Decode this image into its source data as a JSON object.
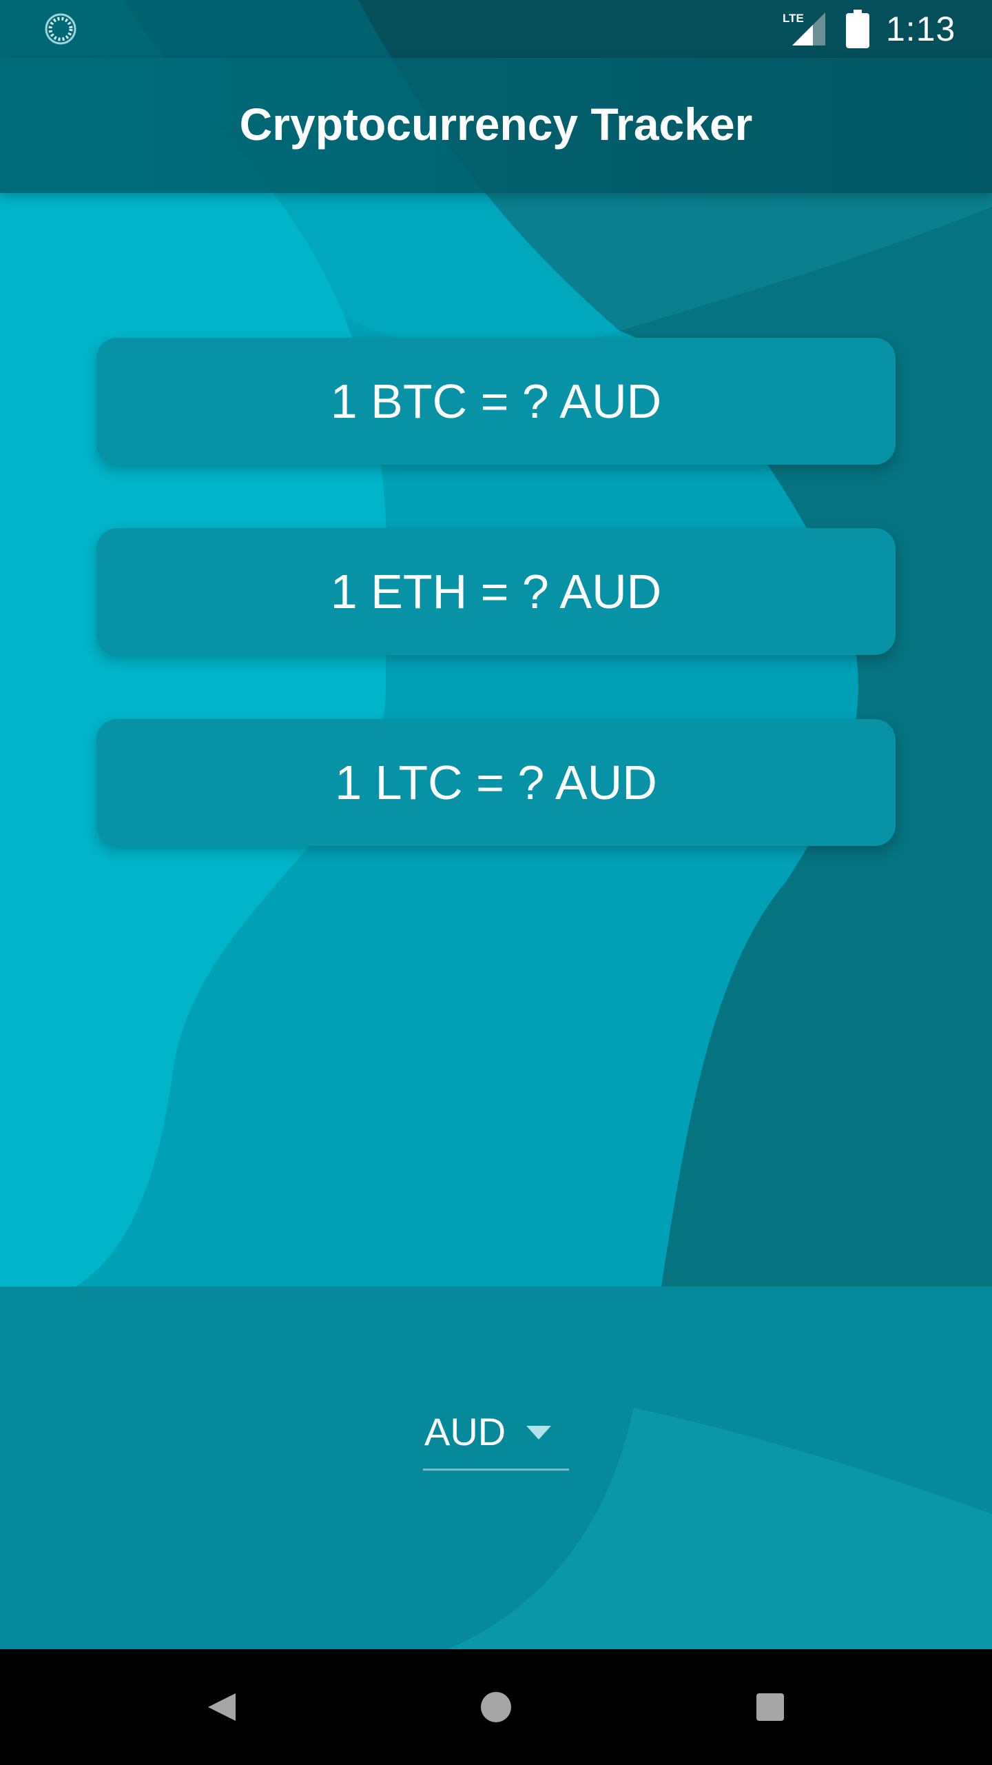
{
  "status_bar": {
    "network_label": "LTE",
    "time": "1:13",
    "icons": [
      "sync-spinner-icon",
      "lte-signal-icon",
      "battery-icon"
    ]
  },
  "app_bar": {
    "title": "Cryptocurrency Tracker"
  },
  "rates": [
    {
      "label": "1 BTC = ? AUD"
    },
    {
      "label": "1 ETH = ? AUD"
    },
    {
      "label": "1 LTC = ? AUD"
    }
  ],
  "currency_picker": {
    "selected": "AUD",
    "icon": "dropdown-arrow-icon"
  },
  "navigation": {
    "icons": [
      "back-icon",
      "home-icon",
      "recents-icon"
    ]
  },
  "colors": {
    "primary": "#00acc1",
    "primary_dark": "#00606c",
    "card": "#0792a6",
    "text": "#ffffff"
  }
}
